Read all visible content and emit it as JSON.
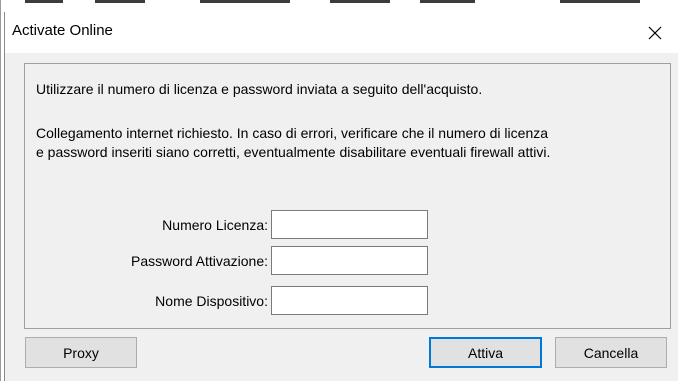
{
  "window": {
    "title": "Activate Online",
    "close_icon": "close-icon"
  },
  "instructions": {
    "line1": "Utilizzare il numero di licenza e password inviata a seguito dell'acquisto.",
    "line2": "Collegamento internet richiesto. In caso di errori, verificare che il numero di licenza\ne password inseriti siano corretti, eventualmente disabilitare eventuali firewall attivi."
  },
  "form": {
    "license_label": "Numero Licenza:",
    "license_value": "",
    "password_label": "Password Attivazione:",
    "password_value": "",
    "device_label": "Nome Dispositivo:",
    "device_value": ""
  },
  "buttons": {
    "proxy": "Proxy",
    "activate": "Attiva",
    "cancel": "Cancella"
  },
  "colors": {
    "dialog_bg": "#f0f0f0",
    "default_button_border": "#0078d7",
    "button_bg": "#e1e1e1"
  }
}
